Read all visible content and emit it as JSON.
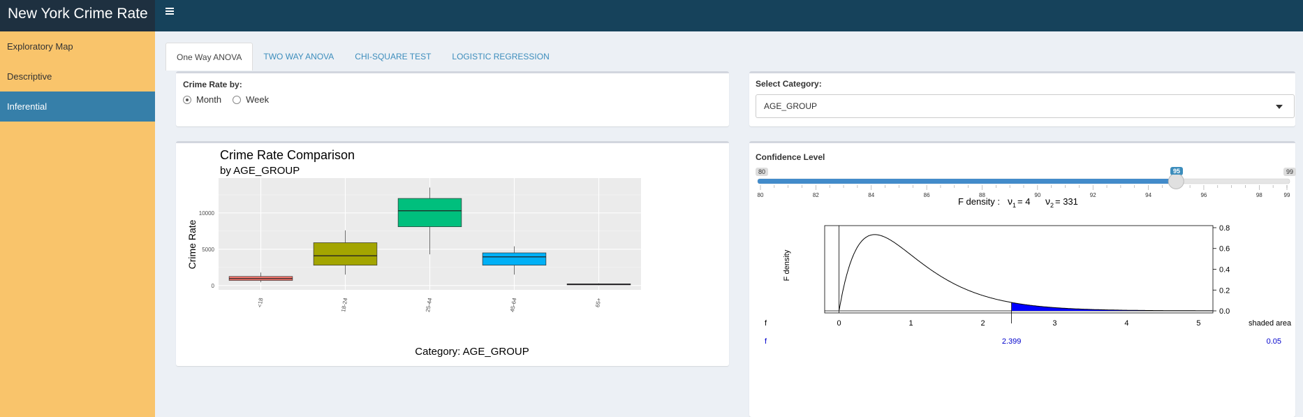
{
  "app": {
    "title": "New York Crime Rate"
  },
  "sidebar": {
    "items": [
      {
        "label": "Exploratory Map"
      },
      {
        "label": "Descriptive"
      },
      {
        "label": "Inferential"
      }
    ]
  },
  "tabs": [
    {
      "label": "One Way ANOVA"
    },
    {
      "label": "TWO WAY ANOVA"
    },
    {
      "label": "CHI-SQUARE TEST"
    },
    {
      "label": "LOGISTIC REGRESSION"
    }
  ],
  "crime_rate_by": {
    "label": "Crime Rate by:",
    "options": [
      "Month",
      "Week"
    ],
    "selected": "Month"
  },
  "category": {
    "label": "Select Category:",
    "value": "AGE_GROUP"
  },
  "confidence": {
    "label": "Confidence Level",
    "min_label": "80",
    "max_label": "99",
    "value_label": "95",
    "min": 80,
    "max": 99,
    "value": 95,
    "ticks": [
      "80",
      "82",
      "84",
      "86",
      "88",
      "90",
      "92",
      "94",
      "96",
      "98",
      "99"
    ]
  },
  "chart_data": [
    {
      "type": "box",
      "title": "Crime Rate Comparison",
      "subtitle": "by AGE_GROUP",
      "xlabel": "Category: AGE_GROUP",
      "ylabel": "Crime Rate",
      "categories": [
        "<18",
        "18-24",
        "25-44",
        "45-64",
        "65+"
      ],
      "y_ticks": [
        "0",
        "5000",
        "10000"
      ],
      "ylim": [
        -600,
        14800
      ],
      "colors": [
        "#f8766d",
        "#a3a500",
        "#00bf7d",
        "#00b0f6",
        "#e76bf3"
      ],
      "boxes": [
        {
          "min": 450,
          "q1": 700,
          "median": 950,
          "q3": 1250,
          "max": 1800
        },
        {
          "min": 1500,
          "q1": 2800,
          "median": 4100,
          "q3": 5900,
          "max": 7600
        },
        {
          "min": 4300,
          "q1": 8100,
          "median": 10300,
          "q3": 12000,
          "max": 13500
        },
        {
          "min": 1500,
          "q1": 2800,
          "median": 3950,
          "q3": 4500,
          "max": 5400
        },
        {
          "min": 50,
          "q1": 120,
          "median": 180,
          "q3": 230,
          "max": 300
        }
      ]
    },
    {
      "type": "area",
      "title_prefix": "F density :",
      "nu1_label": "ν",
      "nu1_sub": "1",
      "nu1_val": "= 4",
      "nu2_label": "ν",
      "nu2_sub": "2",
      "nu2_val": "= 331",
      "ylabel": "F density",
      "df1": 4,
      "df2": 331,
      "critical": 2.399,
      "xlim": [
        -0.2,
        5.2
      ],
      "ylim": [
        -0.02,
        0.82
      ],
      "x_ticks": [
        "0",
        "1",
        "2",
        "3",
        "4",
        "5"
      ],
      "y_ticks": [
        "0.0",
        "0.2",
        "0.4",
        "0.6",
        "0.8"
      ],
      "shade_color": "#0000ff",
      "row1": {
        "left": "f",
        "right": "shaded area"
      },
      "row2": {
        "left": "f",
        "critical_label": "2.399",
        "area_label": "0.05"
      }
    }
  ]
}
